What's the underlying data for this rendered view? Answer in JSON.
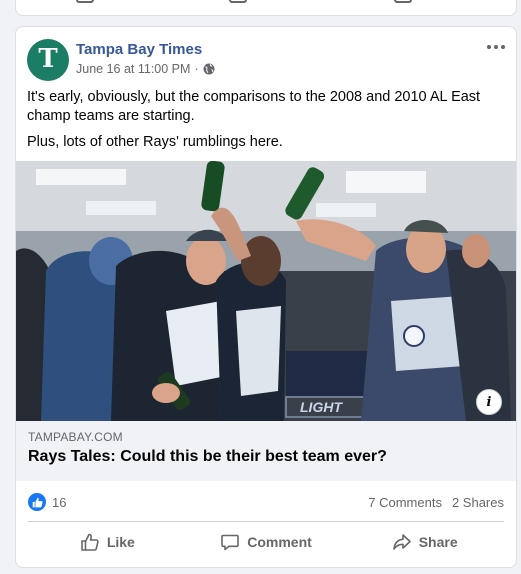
{
  "post": {
    "page_name": "Tampa Bay Times",
    "avatar_letter": "T",
    "date": "June 16 at 11:00 PM",
    "separator": "·",
    "text_1": "It's early, obviously, but the comparisons to the 2008 and 2010 AL East champ teams are starting.",
    "text_2": "Plus, lots of other Rays' rumblings here.",
    "photo_sign_text": "LIGHT",
    "info_label": "i"
  },
  "link": {
    "domain": "TAMPABAY.COM",
    "headline": "Rays Tales: Could this be their best team ever?"
  },
  "stats": {
    "reactions": "16",
    "comments": "7 Comments",
    "shares": "2 Shares"
  },
  "actions": {
    "like": "Like",
    "comment": "Comment",
    "share": "Share"
  },
  "colors": {
    "link_name": "#385898",
    "like_blue": "#1877f2",
    "avatar_green": "#1c7d66"
  }
}
